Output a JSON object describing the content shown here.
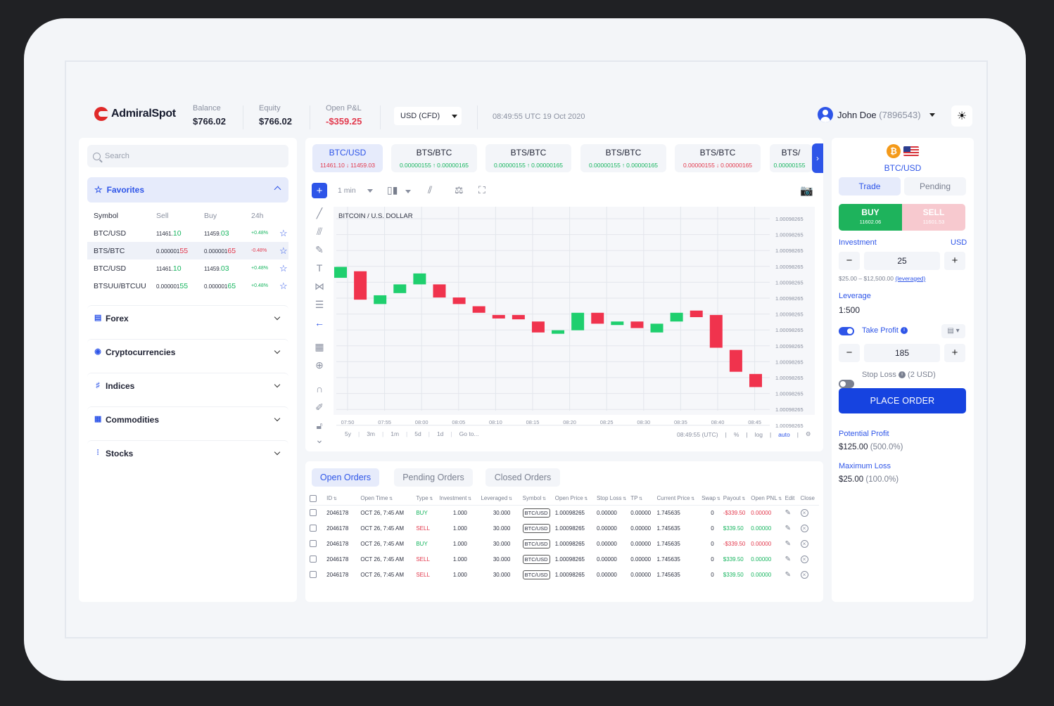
{
  "app": {
    "logo": "AdmiralSpot"
  },
  "header": {
    "balance_label": "Balance",
    "balance_value": "$766.02",
    "equity_label": "Equity",
    "equity_value": "$766.02",
    "pnl_label": "Open P&L",
    "pnl_value": "-$359.25",
    "currency": "USD (CFD)",
    "clock": "08:49:55 UTC 19 Oct 2020",
    "user_name": "John Doe",
    "user_id": "(7896543)"
  },
  "sidebar": {
    "search_placeholder": "Search",
    "favorites_label": "Favorites",
    "columns": {
      "symbol": "Symbol",
      "sell": "Sell",
      "buy": "Buy",
      "change": "24h"
    },
    "favorites": [
      {
        "symbol": "BTC/USD",
        "sell_base": "11461.",
        "sell_hi": "10",
        "buy_base": "11459.",
        "buy_hi": "03",
        "change": "+0.48%",
        "trend": "up"
      },
      {
        "symbol": "BTS/BTC",
        "sell_base": "0.000001",
        "sell_hi": "55",
        "buy_base": "0.000001",
        "buy_hi": "65",
        "change": "-0.48%",
        "trend": "down"
      },
      {
        "symbol": "BTC/USD",
        "sell_base": "11461.",
        "sell_hi": "10",
        "buy_base": "11459.",
        "buy_hi": "03",
        "change": "+0.48%",
        "trend": "up"
      },
      {
        "symbol": "BTSUU/BTCUU",
        "sell_base": "0.000001",
        "sell_hi": "55",
        "buy_base": "0.000001",
        "buy_hi": "65",
        "change": "+0.48%",
        "trend": "up"
      }
    ],
    "categories": [
      "Forex",
      "Cryptocurrencies",
      "Indices",
      "Commodities",
      "Stocks"
    ]
  },
  "symbol_tabs": [
    {
      "name": "BTC/USD",
      "sell": "11461.10",
      "dir": "↓",
      "buy": "11459.03",
      "color": "#e2384c"
    },
    {
      "name": "BTS/BTC",
      "sell": "0.00000155",
      "dir": "↑",
      "buy": "0.00000165",
      "color": "#17b55f"
    },
    {
      "name": "BTS/BTC",
      "sell": "0.00000155",
      "dir": "↑",
      "buy": "0.00000165",
      "color": "#17b55f"
    },
    {
      "name": "BTS/BTC",
      "sell": "0.00000155",
      "dir": "↑",
      "buy": "0.00000165",
      "color": "#17b55f"
    },
    {
      "name": "BTS/BTC",
      "sell": "0.00000155",
      "dir": "↓",
      "buy": "0.00000165",
      "color": "#e2384c"
    },
    {
      "name": "BTS/",
      "sell": "0.00000155",
      "dir": "",
      "buy": "",
      "color": "#17b55f"
    }
  ],
  "chart_toolbar": {
    "interval": "1 min"
  },
  "chart_data": {
    "type": "candlestick",
    "title": "BITCOIN / U.S. DOLLAR",
    "x_ticks": [
      "07:50",
      "07:55",
      "08:00",
      "08:05",
      "08:10",
      "08:15",
      "08:20",
      "08:25",
      "08:30",
      "08:35",
      "08:40",
      "08:45"
    ],
    "y_ticks": [
      "1.00098265",
      "1.00098265",
      "1.00098265",
      "1.00098265",
      "1.00098265",
      "1.00098265",
      "1.00098265",
      "1.00098265",
      "1.00098265",
      "1.00098265",
      "1.00098265",
      "1.00098265",
      "1.00098265",
      "1.00098265"
    ],
    "candles": [
      {
        "open": 95,
        "close": 100
      },
      {
        "open": 98,
        "close": 85
      },
      {
        "open": 83,
        "close": 87
      },
      {
        "open": 88,
        "close": 92
      },
      {
        "open": 92,
        "close": 97
      },
      {
        "open": 92,
        "close": 86
      },
      {
        "open": 86,
        "close": 83
      },
      {
        "open": 82,
        "close": 79
      },
      {
        "open": 78,
        "close": 77
      },
      {
        "open": 78,
        "close": 76
      },
      {
        "open": 75,
        "close": 70
      },
      {
        "open": 70,
        "close": 71
      },
      {
        "open": 71,
        "close": 79
      },
      {
        "open": 79,
        "close": 74
      },
      {
        "open": 74,
        "close": 75
      },
      {
        "open": 75,
        "close": 72
      },
      {
        "open": 70,
        "close": 74
      },
      {
        "open": 75,
        "close": 79
      },
      {
        "open": 80,
        "close": 77
      },
      {
        "open": 78,
        "close": 63
      },
      {
        "open": 62,
        "close": 52
      },
      {
        "open": 51,
        "close": 45
      }
    ],
    "timeframes": [
      "5y",
      "3m",
      "1m",
      "5d",
      "1d",
      "Go to..."
    ],
    "footer_right": [
      "08:49:55 (UTC)",
      "%",
      "log",
      "auto"
    ],
    "grid": true
  },
  "orders": {
    "tabs": [
      "Open Orders",
      "Pending Orders",
      "Closed Orders"
    ],
    "columns": [
      "ID",
      "Open Time",
      "Type",
      "Investment",
      "Leveraged",
      "Symbol",
      "Open Price",
      "Stop Loss",
      "TP",
      "Current Price",
      "Swap",
      "Payout",
      "Open PNL",
      "Edit",
      "Close"
    ],
    "rows": [
      {
        "id": "2046178",
        "time": "OCT 26, 7:45 AM",
        "type": "BUY",
        "investment": "1.000",
        "leveraged": "30.000",
        "symbol": "BTC/USD",
        "open_price": "1.00098265",
        "stop_loss": "0.00000",
        "tp": "0.00000",
        "current_price": "1.745635",
        "swap": "0",
        "payout": "-$339.50",
        "pnl": "0.00000"
      },
      {
        "id": "2046178",
        "time": "OCT 26, 7:45 AM",
        "type": "SELL",
        "investment": "1.000",
        "leveraged": "30.000",
        "symbol": "BTC/USD",
        "open_price": "1.00098265",
        "stop_loss": "0.00000",
        "tp": "0.00000",
        "current_price": "1.745635",
        "swap": "0",
        "payout": "$339.50",
        "pnl": "0.00000"
      },
      {
        "id": "2046178",
        "time": "OCT 26, 7:45 AM",
        "type": "BUY",
        "investment": "1.000",
        "leveraged": "30.000",
        "symbol": "BTC/USD",
        "open_price": "1.00098265",
        "stop_loss": "0.00000",
        "tp": "0.00000",
        "current_price": "1.745635",
        "swap": "0",
        "payout": "-$339.50",
        "pnl": "0.00000"
      },
      {
        "id": "2046178",
        "time": "OCT 26, 7:45 AM",
        "type": "SELL",
        "investment": "1.000",
        "leveraged": "30.000",
        "symbol": "BTC/USD",
        "open_price": "1.00098265",
        "stop_loss": "0.00000",
        "tp": "0.00000",
        "current_price": "1.745635",
        "swap": "0",
        "payout": "$339.50",
        "pnl": "0.00000"
      },
      {
        "id": "2046178",
        "time": "OCT 26, 7:45 AM",
        "type": "SELL",
        "investment": "1.000",
        "leveraged": "30.000",
        "symbol": "BTC/USD",
        "open_price": "1.00098265",
        "stop_loss": "0.00000",
        "tp": "0.00000",
        "current_price": "1.745635",
        "swap": "0",
        "payout": "$339.50",
        "pnl": "0.00000"
      }
    ]
  },
  "trade_panel": {
    "symbol": "BTC/USD",
    "tabs": {
      "trade": "Trade",
      "pending": "Pending"
    },
    "buy_label": "BUY",
    "buy_price": "11602.06",
    "sell_label": "SELL",
    "sell_price": "11601.53",
    "investment_label": "Investment",
    "investment_currency": "USD",
    "investment_value": "25",
    "investment_range": "$25.00 – $12,500.00",
    "leveraged_link": "(leveraged)",
    "leverage_label": "Leverage",
    "leverage_value": "1:500",
    "take_profit_label": "Take Profit",
    "take_profit_value": "185",
    "stop_loss_label": "Stop Loss",
    "stop_loss_note": "(2 USD)",
    "place_order": "PLACE ORDER",
    "potential_profit_label": "Potential Profit",
    "potential_profit_value": "$125.00",
    "potential_profit_pct": "(500.0%)",
    "max_loss_label": "Maximum Loss",
    "max_loss_value": "$25.00",
    "max_loss_pct": "(100.0%)"
  },
  "colors": {
    "accent": "#2e55e8",
    "up": "#17b55f",
    "down": "#e2384c",
    "candle_up": "#1fcf6e",
    "candle_down": "#f0334d"
  }
}
